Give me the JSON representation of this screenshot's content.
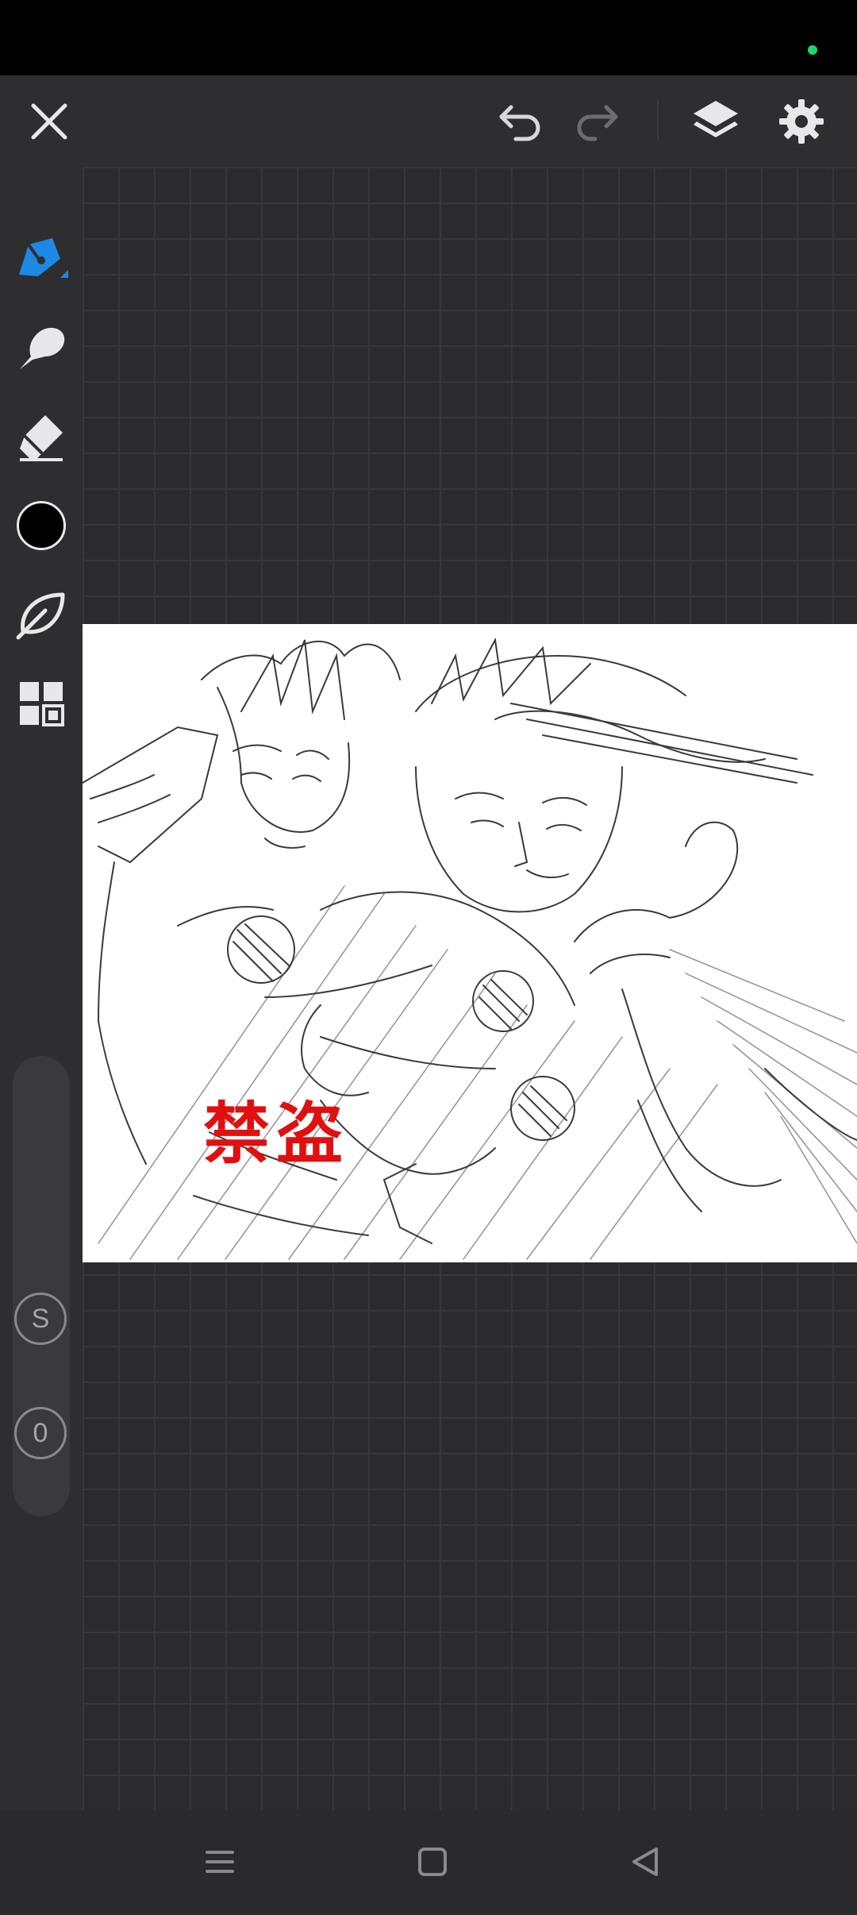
{
  "app": {
    "status_indicator_color": "#1fd66b",
    "accent": "#1e88e5"
  },
  "top_toolbar": {
    "icons": [
      "close-icon",
      "undo-icon",
      "redo-icon",
      "layers-icon",
      "settings-icon"
    ]
  },
  "left_toolbar": {
    "tools": [
      "pen-icon",
      "smudge-brush-icon",
      "eraser-icon",
      "color-swatch",
      "leaf-brush-icon",
      "grid-menu-icon"
    ],
    "current_color": "#000000",
    "size_slider_label": "S",
    "opacity_slider_label": "0"
  },
  "canvas": {
    "watermark_text": "禁盗",
    "watermark_color": "#e01010"
  },
  "nav_bar": {
    "icons": [
      "menu-icon",
      "home-icon",
      "back-icon"
    ]
  }
}
